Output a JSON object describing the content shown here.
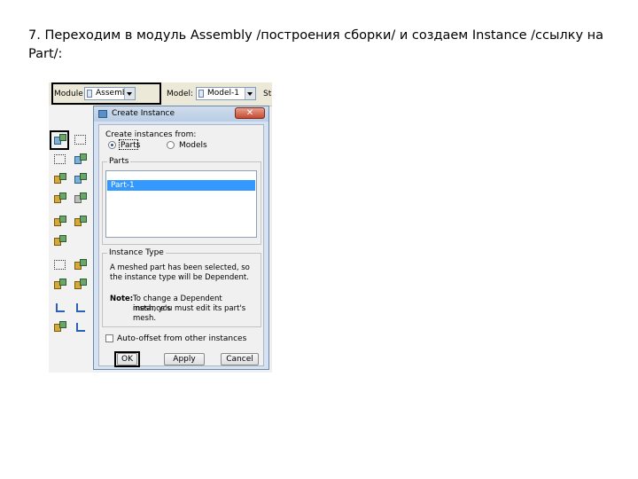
{
  "slide": {
    "text": "7. Переходим в модуль Assembly /построения сборки/ и создаем Instance /ссылку на Part/:"
  },
  "toolbar": {
    "module_label": "Module",
    "module_value": "Assembly",
    "model_label": "Model:",
    "model_value": "Model-1",
    "stub_label": "St"
  },
  "toolbox": {
    "icons": [
      "create-instance-icon",
      "grid-icon",
      "dotted-select-icon",
      "translate-icon",
      "rotate-icon",
      "linear-pattern-icon",
      "radial-pattern-icon",
      "merge-icon",
      "constraint-icon",
      "edit-icon",
      "query-icon",
      "position-icon",
      "face-to-face-icon",
      "coaxial-icon",
      "datum-icon",
      "axis-icon",
      "csys-icon",
      "display-icon"
    ]
  },
  "dialog": {
    "title": "Create Instance",
    "close_glyph": "✕",
    "create_from_label": "Create instances from:",
    "options": [
      "Parts",
      "Models"
    ],
    "selected_option": "Parts",
    "parts_group_title": "Parts",
    "parts": [
      "Part-1"
    ],
    "selected_part": "Part-1",
    "instance_type_title": "Instance Type",
    "info_line1": "A meshed part has been selected, so",
    "info_line2": "the instance type will be Dependent.",
    "note_label": "Note:",
    "note_line1": "To change a Dependent instance's",
    "note_line2": "mesh, you must edit its part's mesh.",
    "auto_offset_label": "Auto-offset from other instances",
    "auto_offset_checked": false,
    "buttons": {
      "ok": "OK",
      "apply": "Apply",
      "cancel": "Cancel"
    }
  }
}
